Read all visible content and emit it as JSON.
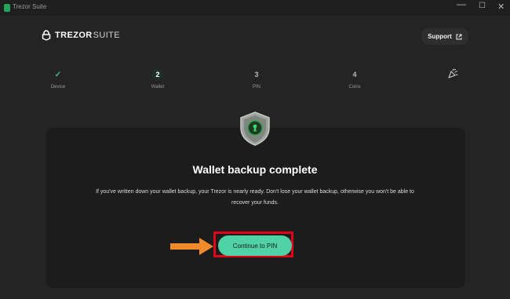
{
  "window": {
    "title": "Trezor Suite",
    "controls": [
      "—",
      "☐",
      "✕"
    ]
  },
  "brand": {
    "bold": "TREZOR",
    "light": "SUITE"
  },
  "header": {
    "support_label": "Support"
  },
  "steps": [
    {
      "mark": "✓",
      "label": "Device",
      "state": "done"
    },
    {
      "mark": "2",
      "label": "Wallet",
      "state": "active"
    },
    {
      "mark": "3",
      "label": "PIN",
      "state": "pending"
    },
    {
      "mark": "4",
      "label": "Coins",
      "state": "pending"
    }
  ],
  "main": {
    "title": "Wallet backup complete",
    "description": "If you've written down your wallet backup, your Trezor is nearly ready. Don't lose your wallet backup, otherwise you won't be able to recover your funds.",
    "cta_label": "Continue to PIN"
  },
  "colors": {
    "accent": "#51d1a6",
    "check": "#3fbd88",
    "highlight_border": "#e3001b",
    "arrow": "#f08a2a",
    "background": "#242424",
    "panel": "#1c1c1c"
  },
  "icons": [
    "trezor-app-icon",
    "lock-logo-icon",
    "external-link-icon",
    "checkmark-icon",
    "party-popper-icon",
    "shield-keyhole-icon",
    "orange-arrow-icon"
  ]
}
